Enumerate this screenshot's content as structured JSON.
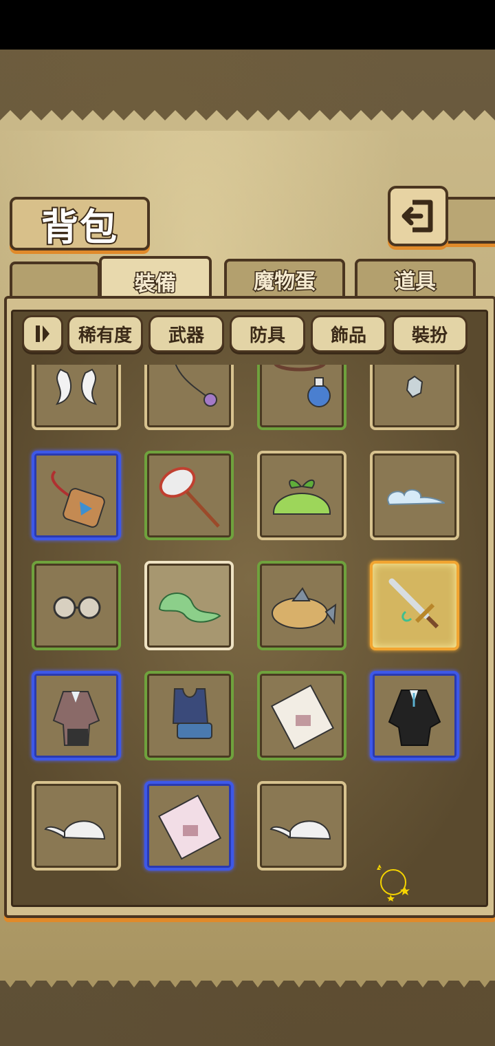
{
  "header": {
    "title": "背包"
  },
  "tabs": [
    {
      "label": "裝備",
      "active": true
    },
    {
      "label": "魔物蛋",
      "active": false
    },
    {
      "label": "道具",
      "active": false
    }
  ],
  "filters": {
    "toggle_icon": "pause-icon",
    "items": [
      "稀有度",
      "武器",
      "防具",
      "飾品",
      "裝扮"
    ]
  },
  "rarity_colors": {
    "common": "#d8c38f",
    "uncommon": "#6fa23d",
    "rare": "#3d58e8",
    "legendary": "#f2a531",
    "white": "#efe3c4"
  },
  "items": [
    {
      "icon": "horns-icon",
      "rarity": "common"
    },
    {
      "icon": "spiky-ball-string-icon",
      "rarity": "common"
    },
    {
      "icon": "potion-necklace-icon",
      "rarity": "uncommon"
    },
    {
      "icon": "crystal-shard-icon",
      "rarity": "common"
    },
    {
      "icon": "charm-pendant-icon",
      "rarity": "rare"
    },
    {
      "icon": "bug-net-icon",
      "rarity": "uncommon"
    },
    {
      "icon": "green-slime-hat-icon",
      "rarity": "common"
    },
    {
      "icon": "cloud-icon",
      "rarity": "common"
    },
    {
      "icon": "round-glasses-icon",
      "rarity": "uncommon"
    },
    {
      "icon": "green-tail-icon",
      "rarity": "white"
    },
    {
      "icon": "fish-pie-icon",
      "rarity": "uncommon"
    },
    {
      "icon": "magic-sword-icon",
      "rarity": "legendary"
    },
    {
      "icon": "female-suit-icon",
      "rarity": "rare"
    },
    {
      "icon": "swimsuit-icon",
      "rarity": "uncommon"
    },
    {
      "icon": "cursed-book-icon",
      "rarity": "uncommon"
    },
    {
      "icon": "black-suit-icon",
      "rarity": "rare"
    },
    {
      "icon": "school-cap-icon",
      "rarity": "common"
    },
    {
      "icon": "cursed-book-pink-icon",
      "rarity": "rare"
    },
    {
      "icon": "school-cap-icon",
      "rarity": "common"
    }
  ]
}
